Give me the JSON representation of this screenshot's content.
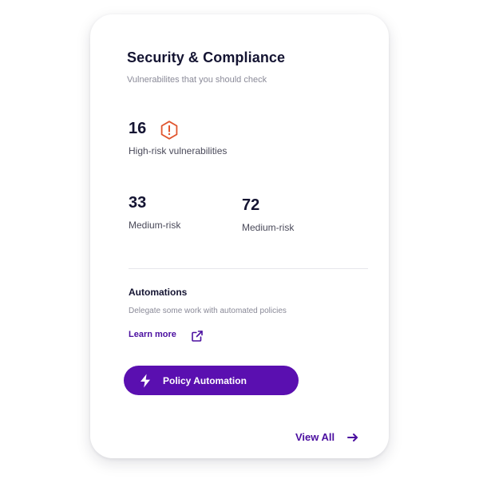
{
  "card": {
    "title": "Security & Compliance",
    "subtitle": "Vulnerabilites that you should check"
  },
  "metrics": {
    "high": {
      "value": "16",
      "label": "High-risk vulnerabilities",
      "icon": "alert-hexagon-icon"
    },
    "medium_a": {
      "value": "33",
      "label": "Medium-risk"
    },
    "medium_b": {
      "value": "72",
      "label": "Medium-risk"
    }
  },
  "automations": {
    "title": "Automations",
    "subtitle": "Delegate some work with automated policies",
    "learn_more": "Learn more",
    "learn_more_icon": "external-link-icon",
    "button_label": "Policy Automation",
    "button_icon": "lightning-bolt-icon"
  },
  "footer": {
    "view_all": "View All",
    "view_all_icon": "arrow-right-icon"
  },
  "colors": {
    "accent": "#5a0fb0",
    "link": "#4b0fa0",
    "danger": "#e0552e",
    "heading": "#141432"
  }
}
